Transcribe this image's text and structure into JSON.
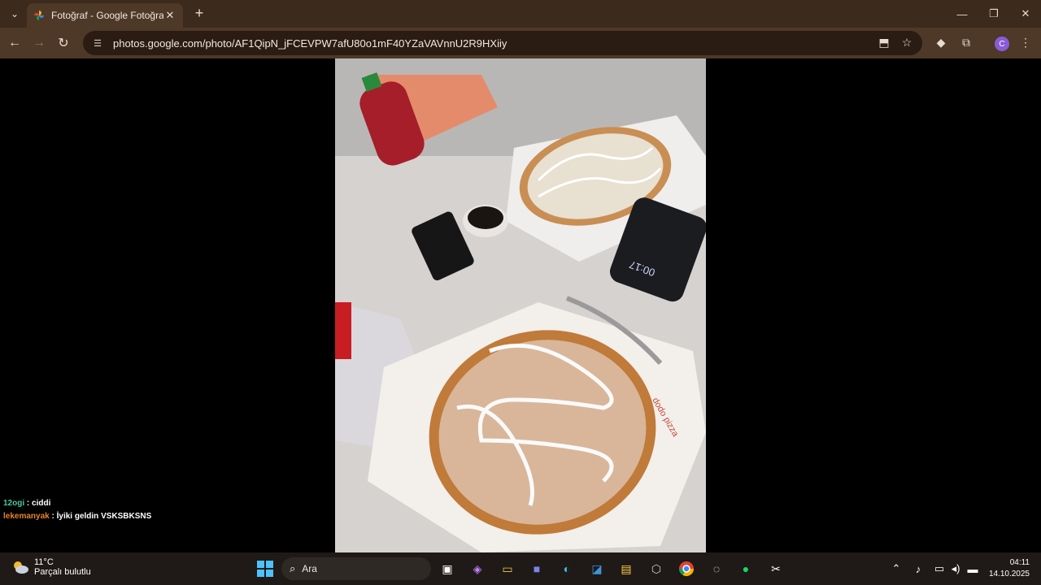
{
  "browser": {
    "tab_title": "Fotoğraf - Google Fotoğraflar",
    "url": "photos.google.com/photo/AF1QipN_jFCEVPW7afU80o1mF40YZaVAVnnU2R9HXiiy",
    "profile_initial": "C"
  },
  "chat": [
    {
      "user": "12ogi",
      "sep": " : ",
      "message": "ciddi"
    },
    {
      "user": "lekemanyak",
      "sep": " : ",
      "message": "İyiki geldin VSKSBKSNS"
    }
  ],
  "photo": {
    "phone_time": "00:17",
    "box_text": "dodo pizza"
  },
  "taskbar": {
    "weather_temp": "11°C",
    "weather_condition": "Parçalı bulutlu",
    "search_placeholder": "Ara",
    "time": "04:11",
    "date": "14.10.2025"
  }
}
